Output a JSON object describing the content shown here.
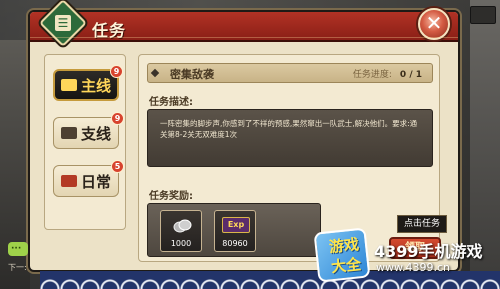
{
  "window": {
    "title": "任务",
    "emblem_glyph": "☰",
    "close_glyph": "✕"
  },
  "tabs": [
    {
      "label": "主线",
      "badge": "9",
      "active": true
    },
    {
      "label": "支线",
      "badge": "9",
      "active": false
    },
    {
      "label": "日常",
      "badge": "5",
      "active": false
    }
  ],
  "task": {
    "name": "密集敌袭",
    "progress_label": "任务进度:",
    "progress_value": "0 / 1",
    "description_label": "任务描述:",
    "description": "一阵密集的脚步声,你感到了不祥的预感,果然窜出一队武士,解决他们。要求:通关第8-2关无双难度1次",
    "reward_label": "任务奖励:",
    "rewards": [
      {
        "icon": "coin-icon",
        "amount": "1000"
      },
      {
        "icon": "exp-icon",
        "icon_text": "Exp",
        "amount": "80960"
      }
    ]
  },
  "actions": {
    "tooltip": "点击任务",
    "claim_label": "领取"
  },
  "bottom_left_text": "下一:",
  "watermark": {
    "logo_text": "游戏大全",
    "title": "4399手机游戏",
    "url": "www.4399.cn"
  },
  "colors": {
    "title_bar": "#a52a1e",
    "active_tab_text": "#ffd65a",
    "panel_bg": "#f3ead2"
  }
}
